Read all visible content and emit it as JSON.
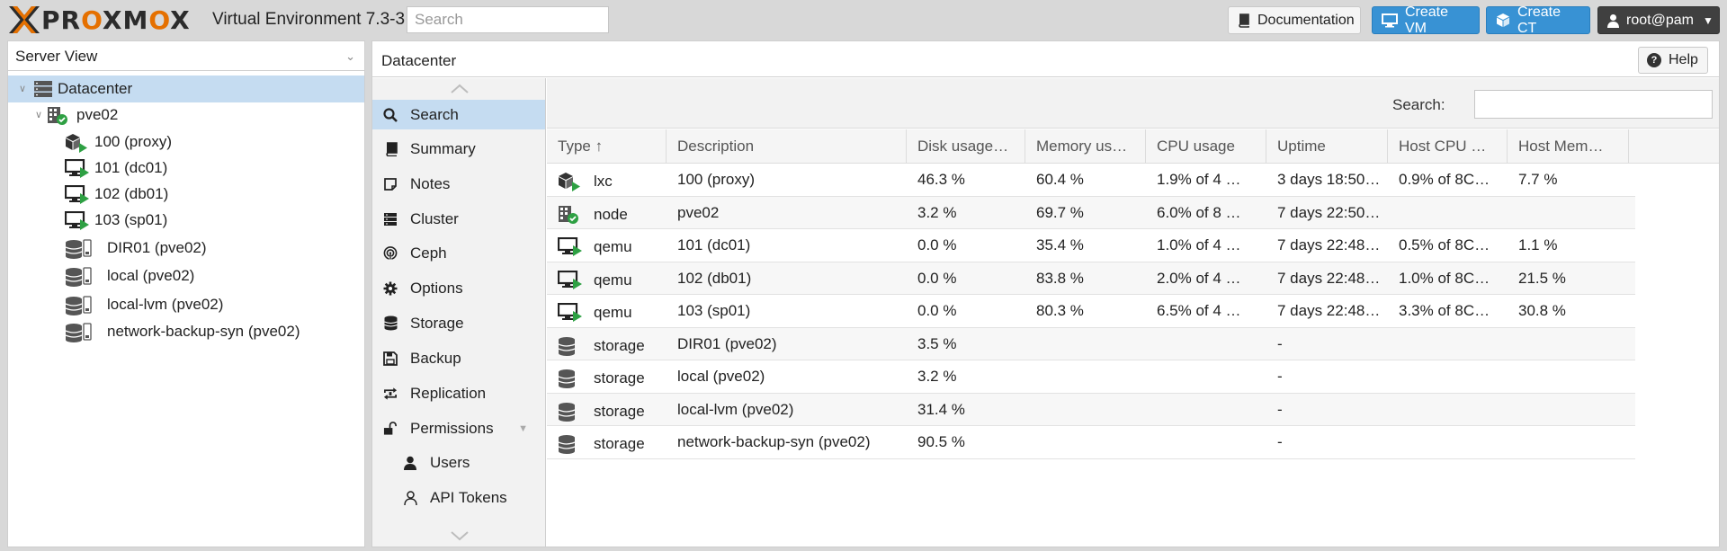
{
  "app": {
    "brand": "PROXMOX",
    "version": "Virtual Environment 7.3-3",
    "search_placeholder": "Search"
  },
  "topbar": {
    "documentation": "Documentation",
    "create_vm": "Create VM",
    "create_ct": "Create CT",
    "user": "root@pam"
  },
  "left": {
    "view": "Server View",
    "tree": [
      {
        "label": "Datacenter",
        "icon": "datacenter-icon",
        "level": 0
      },
      {
        "label": "pve02",
        "icon": "node-online-icon",
        "level": 1
      },
      {
        "label": "100 (proxy)",
        "icon": "container-running-icon",
        "level": 2
      },
      {
        "label": "101 (dc01)",
        "icon": "vm-running-icon",
        "level": 2
      },
      {
        "label": "102 (db01)",
        "icon": "vm-running-icon",
        "level": 2
      },
      {
        "label": "103 (sp01)",
        "icon": "vm-running-icon",
        "level": 2
      },
      {
        "label": "DIR01 (pve02)",
        "icon": "storage-icon",
        "level": 2
      },
      {
        "label": "local (pve02)",
        "icon": "storage-icon",
        "level": 2
      },
      {
        "label": "local-lvm (pve02)",
        "icon": "storage-icon",
        "level": 2
      },
      {
        "label": "network-backup-syn (pve02)",
        "icon": "storage-icon",
        "level": 2
      }
    ]
  },
  "main": {
    "title": "Datacenter",
    "help": "Help",
    "menu": [
      {
        "label": "Search",
        "icon": "search-icon"
      },
      {
        "label": "Summary",
        "icon": "book-icon"
      },
      {
        "label": "Notes",
        "icon": "notes-icon"
      },
      {
        "label": "Cluster",
        "icon": "cluster-icon"
      },
      {
        "label": "Ceph",
        "icon": "ceph-icon"
      },
      {
        "label": "Options",
        "icon": "gear-icon"
      },
      {
        "label": "Storage",
        "icon": "database-icon"
      },
      {
        "label": "Backup",
        "icon": "floppy-icon"
      },
      {
        "label": "Replication",
        "icon": "replication-icon"
      },
      {
        "label": "Permissions",
        "icon": "unlock-icon"
      },
      {
        "label": "Users",
        "icon": "user-icon"
      },
      {
        "label": "API Tokens",
        "icon": "user-outline-icon"
      }
    ],
    "search_label": "Search:",
    "columns": [
      "Type ↑",
      "Description",
      "Disk usage…",
      "Memory us…",
      "CPU usage",
      "Uptime",
      "Host CPU …",
      "Host Mem…"
    ],
    "rows": [
      {
        "type": "lxc",
        "icon": "container-running-icon",
        "desc": "100 (proxy)",
        "disk": "46.3 %",
        "mem": "60.4 %",
        "cpu": "1.9% of 4 …",
        "uptime": "3 days 18:50…",
        "hcpu": "0.9% of 8C…",
        "hmem": "7.7 %"
      },
      {
        "type": "node",
        "icon": "node-online-icon",
        "desc": "pve02",
        "disk": "3.2 %",
        "mem": "69.7 %",
        "cpu": "6.0% of 8 …",
        "uptime": "7 days 22:50…",
        "hcpu": "",
        "hmem": ""
      },
      {
        "type": "qemu",
        "icon": "vm-running-icon",
        "desc": "101 (dc01)",
        "disk": "0.0 %",
        "mem": "35.4 %",
        "cpu": "1.0% of 4 …",
        "uptime": "7 days 22:48…",
        "hcpu": "0.5% of 8C…",
        "hmem": "1.1 %"
      },
      {
        "type": "qemu",
        "icon": "vm-running-icon",
        "desc": "102 (db01)",
        "disk": "0.0 %",
        "mem": "83.8 %",
        "cpu": "2.0% of 4 …",
        "uptime": "7 days 22:48…",
        "hcpu": "1.0% of 8C…",
        "hmem": "21.5 %"
      },
      {
        "type": "qemu",
        "icon": "vm-running-icon",
        "desc": "103 (sp01)",
        "disk": "0.0 %",
        "mem": "80.3 %",
        "cpu": "6.5% of 4 …",
        "uptime": "7 days 22:48…",
        "hcpu": "3.3% of 8C…",
        "hmem": "30.8 %"
      },
      {
        "type": "storage",
        "icon": "storage-icon",
        "desc": "DIR01 (pve02)",
        "disk": "3.5 %",
        "mem": "",
        "cpu": "",
        "uptime": "-",
        "hcpu": "",
        "hmem": ""
      },
      {
        "type": "storage",
        "icon": "storage-icon",
        "desc": "local (pve02)",
        "disk": "3.2 %",
        "mem": "",
        "cpu": "",
        "uptime": "-",
        "hcpu": "",
        "hmem": ""
      },
      {
        "type": "storage",
        "icon": "storage-icon",
        "desc": "local-lvm (pve02)",
        "disk": "31.4 %",
        "mem": "",
        "cpu": "",
        "uptime": "-",
        "hcpu": "",
        "hmem": ""
      },
      {
        "type": "storage",
        "icon": "storage-icon",
        "desc": "network-backup-syn (pve02)",
        "disk": "90.5 %",
        "mem": "",
        "cpu": "",
        "uptime": "-",
        "hcpu": "",
        "hmem": ""
      }
    ]
  },
  "colors": {
    "brand_orange": "#e57000",
    "accent_blue": "#3892d4",
    "selection": "#c5dcf1",
    "running_green": "#2ea043"
  }
}
